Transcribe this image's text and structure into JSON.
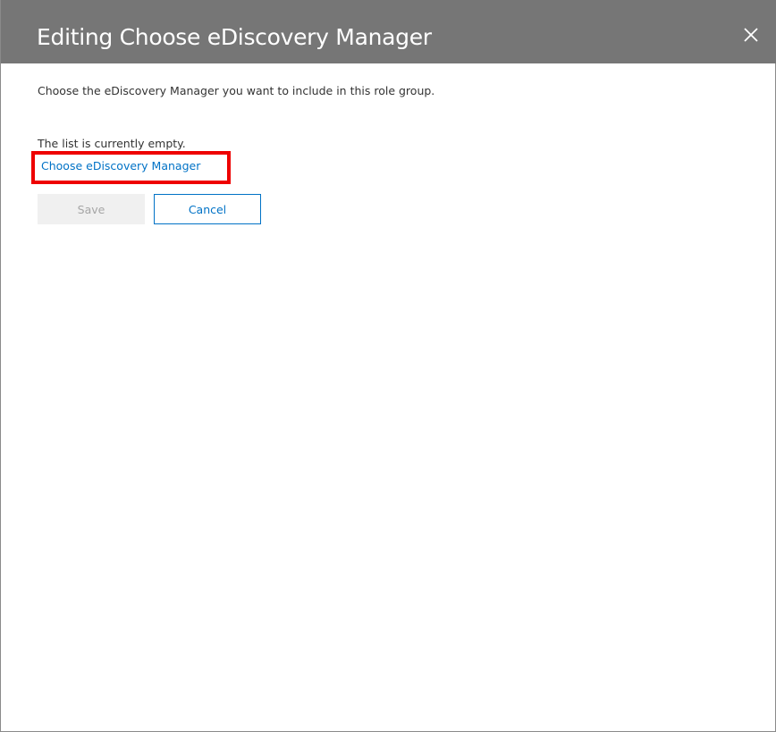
{
  "dialog": {
    "title": "Editing Choose eDiscovery Manager",
    "close_icon": "close-icon",
    "description": "Choose the eDiscovery Manager you want to include in this role group.",
    "empty_text": "The list is currently empty.",
    "choose_link_label": "Choose eDiscovery Manager",
    "save_label": "Save",
    "cancel_label": "Cancel"
  },
  "colors": {
    "header_bg": "#767676",
    "link": "#0072c6",
    "highlight": "#ee0000",
    "disabled_button_bg": "#f0f0f0",
    "disabled_button_text": "#a6a6a6"
  }
}
